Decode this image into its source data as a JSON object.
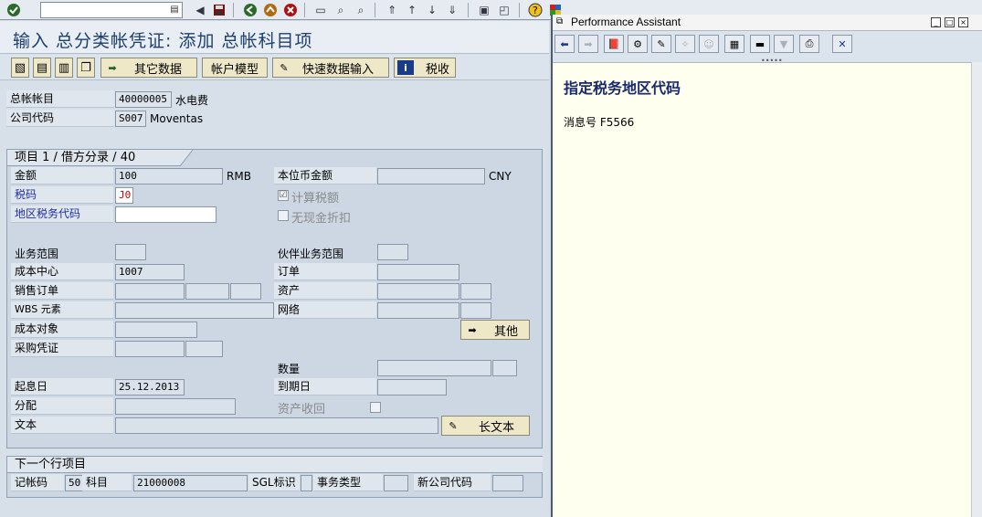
{
  "systool": {
    "command_placeholder": ""
  },
  "main": {
    "title": "输入 总分类帐凭证: 添加 总帐科目项",
    "toolbar": {
      "other_data": "其它数据",
      "account_model": "帐户模型",
      "fast_entry": "快速数据输入",
      "tax": "税收"
    },
    "header": {
      "gl_account_label": "总帐帐目",
      "gl_account_value": "40000005",
      "gl_account_text": "水电费",
      "company_code_label": "公司代码",
      "company_code_value": "S007",
      "company_code_text": "Moventas"
    },
    "item": {
      "heading": "项目 1 / 借方分录 / 40",
      "amount_label": "金额",
      "amount_value": "100",
      "amount_currency": "RMB",
      "local_amount_label": "本位币金额",
      "local_currency": "CNY",
      "tax_code_label": "税码",
      "tax_code_value": "J0",
      "calc_tax_label": "计算税额",
      "calc_tax_checked": "☑",
      "region_tax_label": "地区税务代码",
      "no_discount_label": "无现金折扣",
      "business_area_label": "业务范围",
      "partner_ba_label": "伙伴业务范围",
      "cost_center_label": "成本中心",
      "cost_center_value": "1007",
      "order_label": "订单",
      "sales_order_label": "销售订单",
      "asset_label": "资产",
      "wbs_label": "WBS 元素",
      "network_label": "网络",
      "cost_object_label": "成本对象",
      "more_button": "其他",
      "purchase_doc_label": "采购凭证",
      "quantity_label": "数量",
      "value_date_label": "起息日",
      "value_date_value": "25.12.2013",
      "due_date_label": "到期日",
      "assignment_label": "分配",
      "asset_retirement_label": "资产收回",
      "text_label": "文本",
      "long_text_button": "长文本"
    },
    "next": {
      "heading": "下一个行项目",
      "posting_key_label": "记帐码",
      "posting_key_value": "50",
      "account_label": "科目",
      "account_value": "21000008",
      "sgl_label": "SGL标识",
      "trans_type_label": "事务类型",
      "new_company_label": "新公司代码"
    }
  },
  "assistant": {
    "title": "Performance Assistant",
    "heading": "指定税务地区代码",
    "message": "消息号 F5566"
  },
  "colors": {
    "title_text": "#1f3f6d",
    "button_bg": "#efe8c8",
    "help_bg": "#fffff0"
  }
}
